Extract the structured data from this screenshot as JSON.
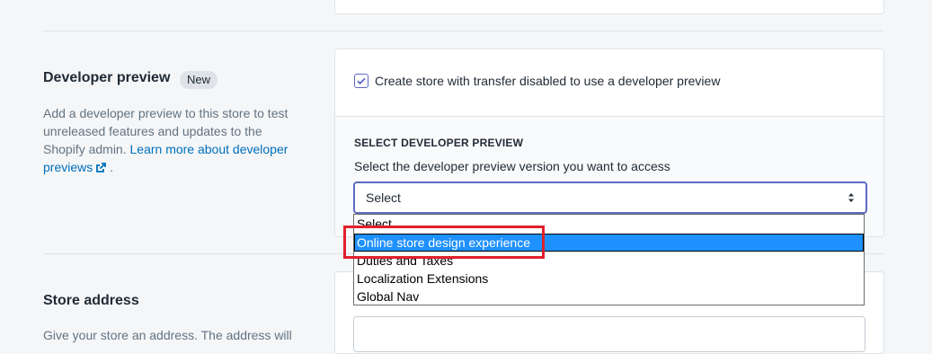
{
  "developer_preview": {
    "title": "Developer preview",
    "badge": "New",
    "description_text": "Add a developer preview to this store to test unreleased features and updates to the Shopify admin.",
    "learn_more_link": "Learn more about developer previews",
    "description_end": ".",
    "checkbox_label": "Create store with transfer disabled to use a developer preview",
    "checkbox_checked": true,
    "select_heading": "SELECT DEVELOPER PREVIEW",
    "select_help": "Select the developer preview version you want to access",
    "select_value": "Select",
    "options": [
      "Select",
      "Online store design experience",
      "Duties and Taxes",
      "Localization Extensions",
      "Global Nav"
    ],
    "highlighted_option_index": 1
  },
  "store_address": {
    "title": "Store address",
    "description": "Give your store an address. The address will"
  },
  "colors": {
    "accent": "#5c6ac4",
    "link": "#006fbb",
    "highlight_box": "#e0202b",
    "option_selected": "#1e90ff"
  }
}
